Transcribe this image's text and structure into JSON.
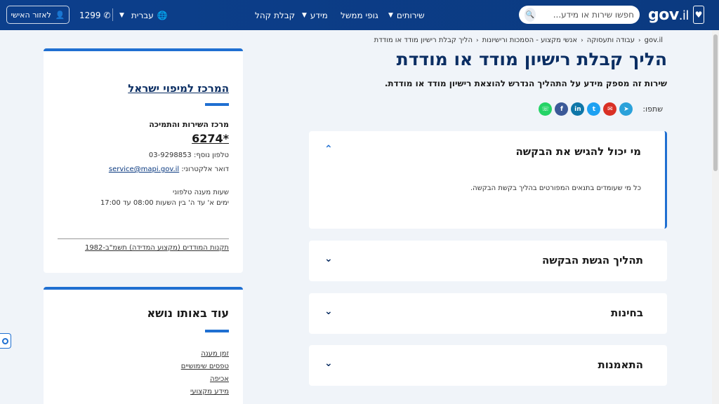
{
  "header": {
    "logo_text": "gov",
    "logo_suffix": ".il",
    "search_placeholder": "חפשו שירות או מידע...",
    "nav": {
      "services": "שירותים",
      "gov_bodies": "גופי ממשל",
      "info": "מידע",
      "public_reception": "קבלת קהל"
    },
    "language": "עברית",
    "phone": "1299",
    "personal_area": "לאזור האישי"
  },
  "breadcrumb": {
    "items": [
      "gov.il",
      "עבודה ותעסוקה",
      "אנשי מקצוע - הסמכות ורישיונות",
      "הליך קבלת רישיון מודד או מודדת"
    ]
  },
  "page": {
    "title": "הליך קבלת רישיון מודד או מודדת",
    "subtitle": "שירות זה מספק מידע על התהליך הנדרש להוצאת רישיון מודד או מודדת.",
    "share_label": "שתפו:"
  },
  "accordions": [
    {
      "title": "מי יכול להגיש את הבקשה",
      "body": "כל מי שעומדים בתנאים המפורטים בהליך בקשת הבקשה."
    },
    {
      "title": "תהליך הגשת הבקשה"
    },
    {
      "title": "בחינות"
    },
    {
      "title": "התאמנות"
    }
  ],
  "contact_card": {
    "title": "המרכז למיפוי ישראל",
    "support_title": "מרכז השירות והתמיכה",
    "support_number": "*6274",
    "extra_phone": "טלפון נוסף: 03-9298853",
    "email_label": "דואר אלקטרוני: ",
    "email": "service@mapi.gov.il",
    "hours_label": "שעות מענה טלפוני",
    "hours_value": "ימים א' עד ה' בין השעות 08:00 עד 17:00",
    "regulations_link": "תקנות המודדים (מקצוע המדידה) תשמ\"ב-1982"
  },
  "more_card": {
    "title": "עוד באותו נושא",
    "links": [
      "זמן מענה",
      "טפסים שימושיים",
      "אכיפה",
      "מידע מקצועי"
    ]
  },
  "colors": {
    "header_bg": "#0c3f8c",
    "accent": "#1f6fd1",
    "title": "#0b2e63",
    "whatsapp": "#25d366",
    "facebook": "#3b5998",
    "linkedin": "#0e76a8",
    "twitter": "#1da1f2",
    "email": "#d93025",
    "telegram": "#2aa1da"
  }
}
